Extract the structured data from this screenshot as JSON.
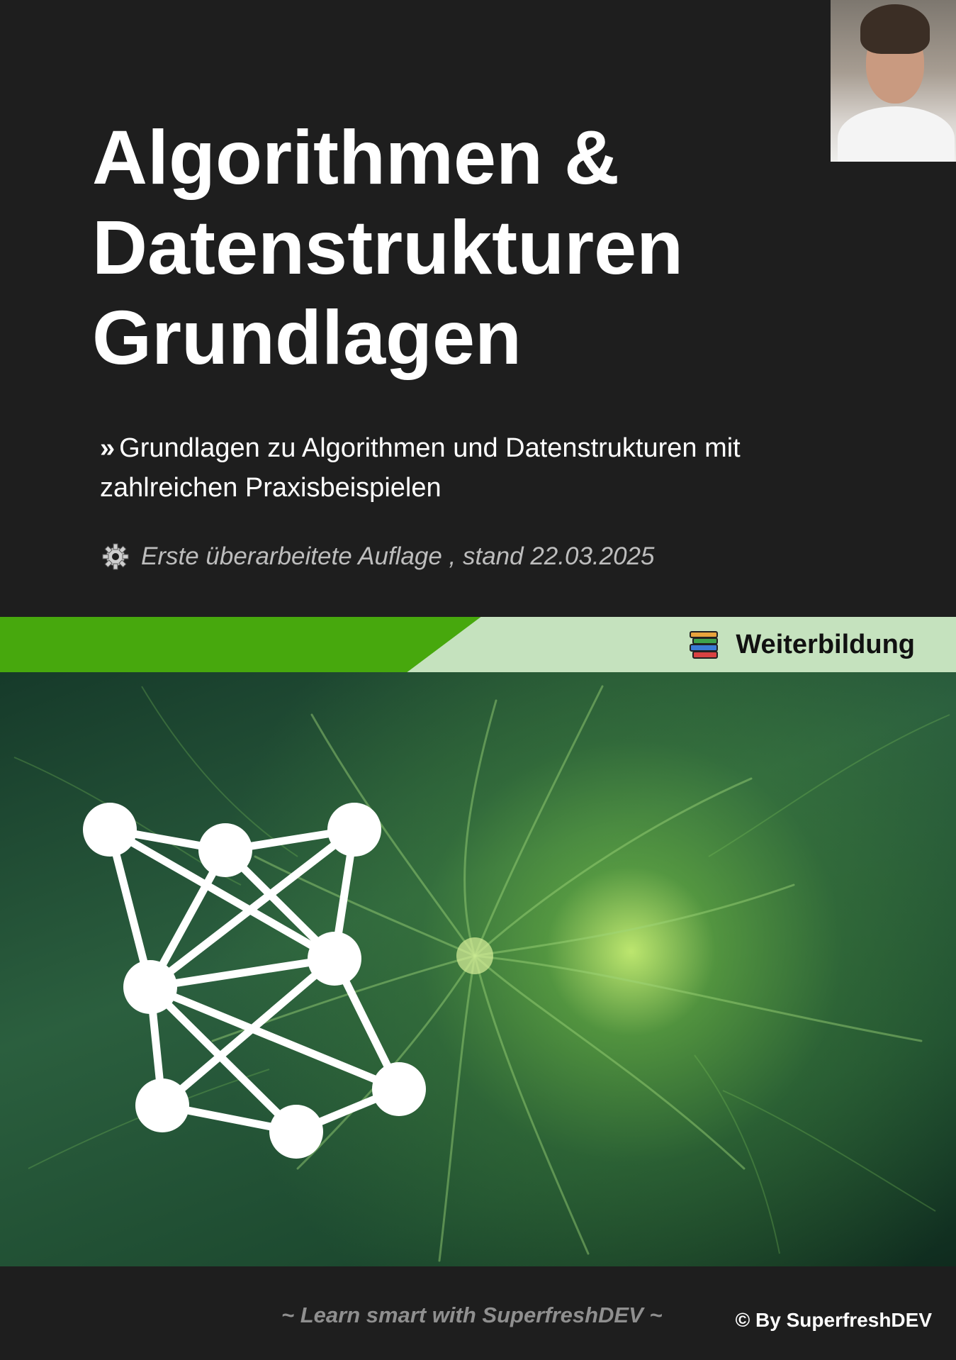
{
  "cover": {
    "title_lines": [
      "Algorithmen &",
      "Datenstrukturen",
      "Grundlagen"
    ],
    "subtitle_marker": "»",
    "subtitle": "Grundlagen zu Algorithmen und Datenstrukturen mit zahlreichen Praxisbeispielen",
    "edition_icon": "gear-icon",
    "edition": "Erste überarbeitete Auflage , stand 22.03.2025",
    "category_icon": "books-icon",
    "category": "Weiterbildung",
    "slogan": "~ Learn smart with SuperfreshDEV ~",
    "copyright": "© By SuperfreshDEV"
  },
  "colors": {
    "background": "#1e1e1e",
    "accent_green": "#47a80d",
    "band_light_green": "#c5e2be",
    "slogan_gray": "#8f8f8f",
    "edition_gray": "#bdbdbd"
  }
}
